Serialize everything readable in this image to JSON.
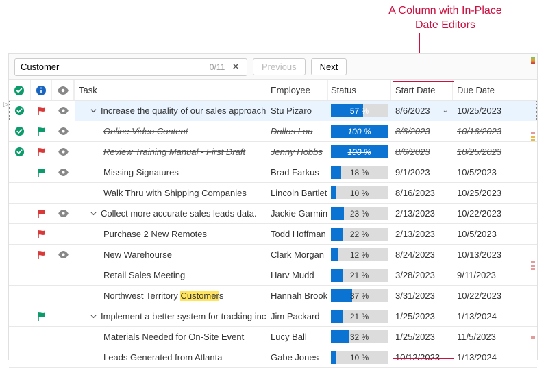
{
  "annotation": {
    "line1": "A Column with In-Place",
    "line2": "Date Editors"
  },
  "toolbar": {
    "search_value": "Customer",
    "search_count": "0/11",
    "prev_label": "Previous",
    "next_label": "Next"
  },
  "columns": {
    "task": "Task",
    "employee": "Employee",
    "status": "Status",
    "start": "Start Date",
    "due": "Due Date"
  },
  "icons": {
    "check": "check-circle",
    "info": "info-circle",
    "eye": "eye"
  },
  "rows": [
    {
      "level": 1,
      "expander": true,
      "selected": true,
      "check": "green",
      "flag": "red",
      "eye": true,
      "task": "Increase the quality of our sales approach.",
      "employee": "Stu Pizaro",
      "status": 57,
      "start": "8/6/2023",
      "due": "10/25/2023",
      "editor": true
    },
    {
      "level": 2,
      "done": true,
      "check": "green",
      "flag": "green",
      "eye": true,
      "task": "Online Video Content",
      "employee": "Dallas Lou",
      "status": 100,
      "start": "8/6/2023",
      "due": "10/16/2023"
    },
    {
      "level": 2,
      "done": true,
      "check": "green",
      "flag": "red",
      "eye": true,
      "task": "Review Training Manual - First Draft",
      "employee": "Jenny Hobbs",
      "status": 100,
      "start": "8/6/2023",
      "due": "10/25/2023"
    },
    {
      "level": 2,
      "flag": "green",
      "eye": true,
      "task": "Missing Signatures",
      "employee": "Brad Farkus",
      "status": 18,
      "start": "9/1/2023",
      "due": "10/5/2023"
    },
    {
      "level": 2,
      "task": "Walk Thru with Shipping Companies",
      "employee": "Lincoln Bartlett",
      "status": 10,
      "start": "8/16/2023",
      "due": "10/25/2023"
    },
    {
      "level": 1,
      "expander": true,
      "flag": "red",
      "eye": true,
      "task": "Collect more accurate sales leads data.",
      "employee": "Jackie Garmin",
      "status": 23,
      "start": "2/13/2023",
      "due": "10/22/2023"
    },
    {
      "level": 2,
      "flag": "red",
      "task": "Purchase 2 New Remotes",
      "employee": "Todd Hoffman",
      "status": 22,
      "start": "2/13/2023",
      "due": "10/5/2023"
    },
    {
      "level": 2,
      "flag": "red",
      "eye": true,
      "task": "New Warehourse",
      "employee": "Clark Morgan",
      "status": 12,
      "start": "8/24/2023",
      "due": "10/13/2023"
    },
    {
      "level": 2,
      "task": "Retail Sales Meeting",
      "employee": "Harv Mudd",
      "status": 21,
      "start": "3/28/2023",
      "due": "9/11/2023"
    },
    {
      "level": 2,
      "task_pre": "Northwest Territory ",
      "task_hilite": "Customer",
      "task_post": "s",
      "employee": "Hannah Brookly",
      "status": 37,
      "start": "3/31/2023",
      "due": "10/22/2023"
    },
    {
      "level": 1,
      "expander": true,
      "flag": "green",
      "task": "Implement a better system for tracking incoming",
      "employee": "Jim Packard",
      "status": 21,
      "start": "1/25/2023",
      "due": "1/13/2024"
    },
    {
      "level": 2,
      "task": "Materials Needed for On-Site Event",
      "employee": "Lucy Ball",
      "status": 32,
      "start": "1/25/2023",
      "due": "11/5/2023"
    },
    {
      "level": 2,
      "task": "Leads Generated from Atlanta",
      "employee": "Gabe Jones",
      "status": 10,
      "start": "10/12/2023",
      "due": "1/13/2024"
    }
  ]
}
